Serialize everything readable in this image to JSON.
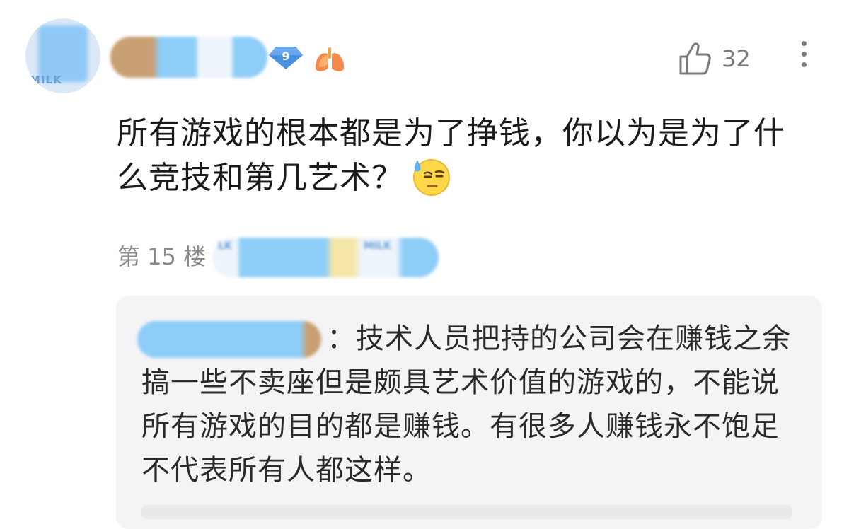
{
  "author": {
    "level": "9"
  },
  "actions": {
    "like_count": "32"
  },
  "post": {
    "text": "所有游戏的根本都是为了挣钱，你以为是为了什么竞技和第几艺术？"
  },
  "floor": {
    "label": "第 15 楼"
  },
  "signature": {
    "text_fragments": [
      "LK",
      "MILK"
    ]
  },
  "avatar": {
    "label": "MILK"
  },
  "quote": {
    "separator": "：",
    "text": "技术人员把持的公司会在赚钱之余搞一些不卖座但是颇具艺术价值的游戏的，不能说所有游戏的目的都是赚钱。有很多人赚钱永不饱足不代表所有人都这样。"
  },
  "colors": {
    "level_badge": "#4a8fe0",
    "muted_text": "#7a7a7a",
    "quote_bg": "#f4f4f6"
  }
}
